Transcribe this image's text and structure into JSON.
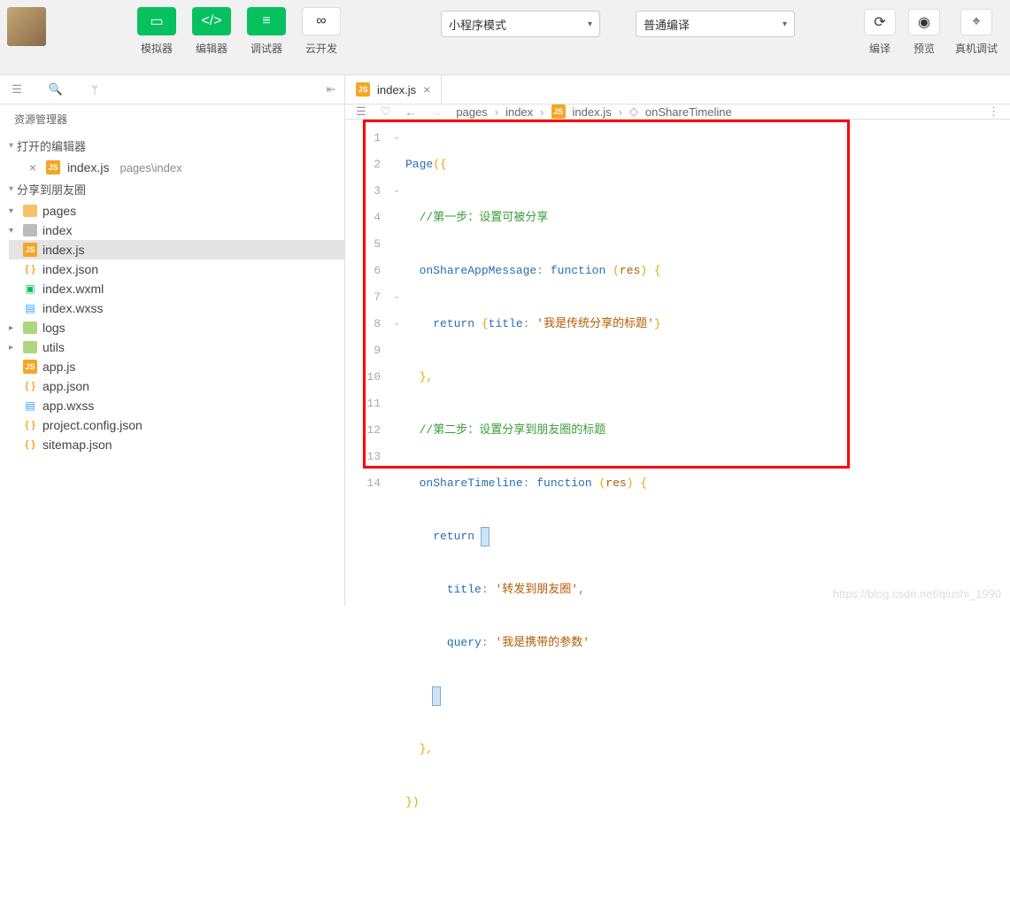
{
  "topbar": {
    "tools": [
      {
        "label": "模拟器",
        "icon": "phone"
      },
      {
        "label": "编辑器",
        "icon": "code"
      },
      {
        "label": "调试器",
        "icon": "settings"
      },
      {
        "label": "云开发",
        "icon": "cloud"
      }
    ],
    "mode_select": "小程序模式",
    "compile_select": "普通编译",
    "right_tools": [
      {
        "label": "编译",
        "icon": "refresh"
      },
      {
        "label": "预览",
        "icon": "eye"
      },
      {
        "label": "真机调试",
        "icon": "device"
      }
    ]
  },
  "sidebar": {
    "explorer_title": "资源管理器",
    "open_editors": "打开的编辑器",
    "open_file": {
      "name": "index.js",
      "path": "pages\\index"
    },
    "workspace": "分享到朋友圈",
    "tree": {
      "pages": "pages",
      "index_folder": "index",
      "index_js": "index.js",
      "index_json": "index.json",
      "index_wxml": "index.wxml",
      "index_wxss": "index.wxss",
      "logs": "logs",
      "utils": "utils",
      "app_js": "app.js",
      "app_json": "app.json",
      "app_wxss": "app.wxss",
      "project_config": "project.config.json",
      "sitemap": "sitemap.json"
    }
  },
  "tab": {
    "name": "index.js"
  },
  "breadcrumbs": [
    "pages",
    "index",
    "index.js",
    "onShareTimeline"
  ],
  "code": {
    "l1_page": "Page",
    "l1_open": "({",
    "l2_comment": "//第一步：设置可被分享",
    "l3_attr": "onShareAppMessage",
    "l3_fn": "function",
    "l3_arg": "res",
    "l4_return": "return",
    "l4_title_key": "title",
    "l4_title_val": "'我是传统分享的标题'",
    "l5": "},",
    "l6_comment": "//第二步：设置分享到朋友圈的标题",
    "l7_attr": "onShareTimeline",
    "l7_fn": "function",
    "l7_arg": "res",
    "l8_return": "return",
    "l9_key": "title",
    "l9_val": "'转发到朋友圈'",
    "l10_key": "query",
    "l10_val": "'我是携带的参数'",
    "l12": "},",
    "l13": "})"
  },
  "line_numbers": [
    "1",
    "2",
    "3",
    "4",
    "5",
    "6",
    "7",
    "8",
    "9",
    "10",
    "11",
    "12",
    "13",
    "14"
  ],
  "fold_markers": {
    "1": "⌄",
    "3": "⌄",
    "7": "⌄",
    "8": "⌄"
  },
  "watermark": "https://blog.csdn.net/qiushi_1990"
}
